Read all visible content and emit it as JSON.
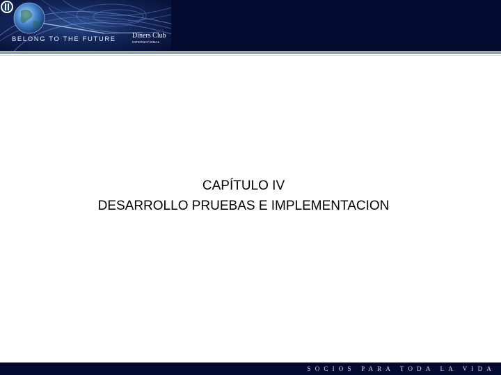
{
  "header": {
    "banner_tagline": "BELONG TO THE FUTURE",
    "brand_name": "Diners Club",
    "brand_sub": "INTERNATIONAL"
  },
  "slide": {
    "title_line1": "CAPÍTULO IV",
    "title_line2": "DESARROLLO PRUEBAS E IMPLEMENTACION"
  },
  "footer": {
    "tagline": "SOCIOS PARA TODA LA VIDA"
  },
  "colors": {
    "header_background": "#030a30",
    "rule": "#8aa0c4",
    "footer_background": "#030a30",
    "text": "#000000"
  },
  "icons": {
    "globe": "globe-icon",
    "brand_logo": "diners-club-logo-icon"
  }
}
